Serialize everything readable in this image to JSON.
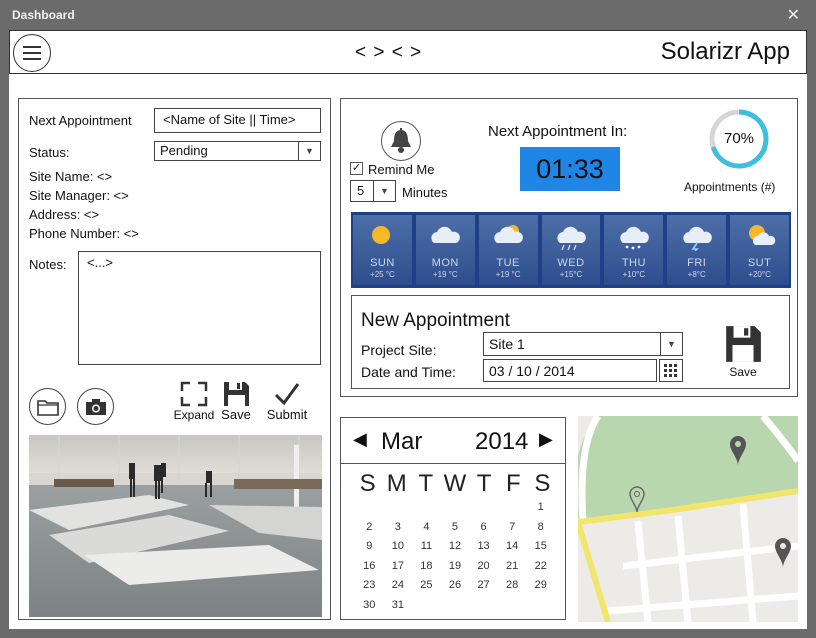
{
  "window": {
    "title": "Dashboard",
    "close_glyph": "✕"
  },
  "header": {
    "nav_arrows": "< > < >",
    "app_title": "Solarizr App"
  },
  "appointment_form": {
    "next_appointment_label": "Next Appointment",
    "next_appointment_value": "<Name of Site || Time>",
    "status_label": "Status:",
    "status_value": "Pending",
    "site_name": "Site Name: <>",
    "site_manager": "Site Manager: <>",
    "address": "Address: <>",
    "phone_number": "Phone Number: <>",
    "notes_label": "Notes:",
    "notes_value": "<...>"
  },
  "tools": {
    "expand": "Expand",
    "save": "Save",
    "submit": "Submit"
  },
  "reminder": {
    "remind_me": "Remind Me",
    "remind_checked": true,
    "minutes_value": "5",
    "minutes_label": "Minutes",
    "next_in_label": "Next Appointment In:",
    "countdown": "01:33",
    "progress_text": "70%",
    "progress_fraction": 0.7,
    "progress_label": "Appointments (#)"
  },
  "weather": [
    {
      "day": "SUN",
      "temp": "+25 °C",
      "icon": "sun-icon"
    },
    {
      "day": "MON",
      "temp": "+19 °C",
      "icon": "cloud-icon"
    },
    {
      "day": "TUE",
      "temp": "+19 °C",
      "icon": "cloud-sun-icon"
    },
    {
      "day": "WED",
      "temp": "+15°C",
      "icon": "rain-cloud-icon"
    },
    {
      "day": "THU",
      "temp": "+10°C",
      "icon": "snow-cloud-icon"
    },
    {
      "day": "FRI",
      "temp": "+8°C",
      "icon": "storm-cloud-icon"
    },
    {
      "day": "SUT",
      "temp": "+20°C",
      "icon": "sun-cloud-icon"
    }
  ],
  "new_appointment": {
    "heading": "New Appointment",
    "project_site_label": "Project Site:",
    "project_site_value": "Site 1",
    "date_time_label": "Date and Time:",
    "date_time_value": "03 / 10 / 2014",
    "save_label": "Save"
  },
  "calendar": {
    "month": "Mar",
    "year": "2014",
    "weekdays": [
      "S",
      "M",
      "T",
      "W",
      "T",
      "F",
      "S"
    ],
    "days": [
      "",
      "",
      "",
      "",
      "",
      "",
      "1",
      "2",
      "3",
      "4",
      "5",
      "6",
      "7",
      "8",
      "9",
      "10",
      "11",
      "12",
      "13",
      "14",
      "15",
      "16",
      "17",
      "18",
      "19",
      "20",
      "21",
      "22",
      "23",
      "24",
      "25",
      "26",
      "27",
      "28",
      "29",
      "30",
      "31",
      "",
      "",
      "",
      "",
      ""
    ]
  },
  "colors": {
    "accent_blue": "#1f86e6",
    "progress_ring": "#3cc0de",
    "weather_bg": "#1f3f87"
  }
}
